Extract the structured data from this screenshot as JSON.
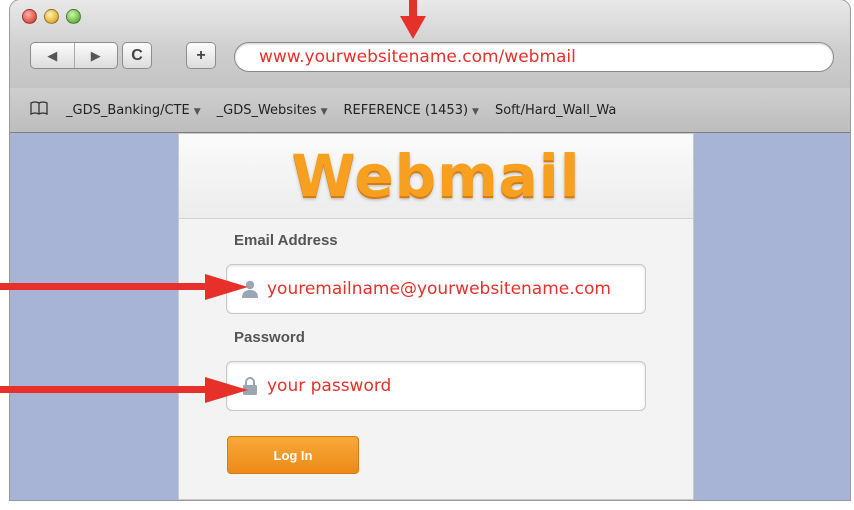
{
  "browser": {
    "url": "www.yourwebsitename.com/webmail",
    "nav": {
      "back_icon": "◀",
      "forward_icon": "▶",
      "reload_icon": "C",
      "add_icon": "+"
    },
    "bookmarks_icon": "book-icon",
    "bookmarks": [
      {
        "label": "_GDS_Banking/CTE",
        "caret": "▼"
      },
      {
        "label": "_GDS_Websites",
        "caret": "▼"
      },
      {
        "label": "REFERENCE (1453)",
        "caret": "▼"
      },
      {
        "label": "Soft/Hard_Wall_Wa",
        "caret": ""
      }
    ]
  },
  "login": {
    "logo": "Webmail",
    "email_label": "Email Address",
    "email_value": "youremailname@yourwebsitename.com",
    "password_label": "Password",
    "password_value": "your password",
    "button_label": "Log In"
  },
  "colors": {
    "accent_orange": "#f7a020",
    "annotation_red": "#e8302a",
    "page_background": "#a7b4d6"
  }
}
